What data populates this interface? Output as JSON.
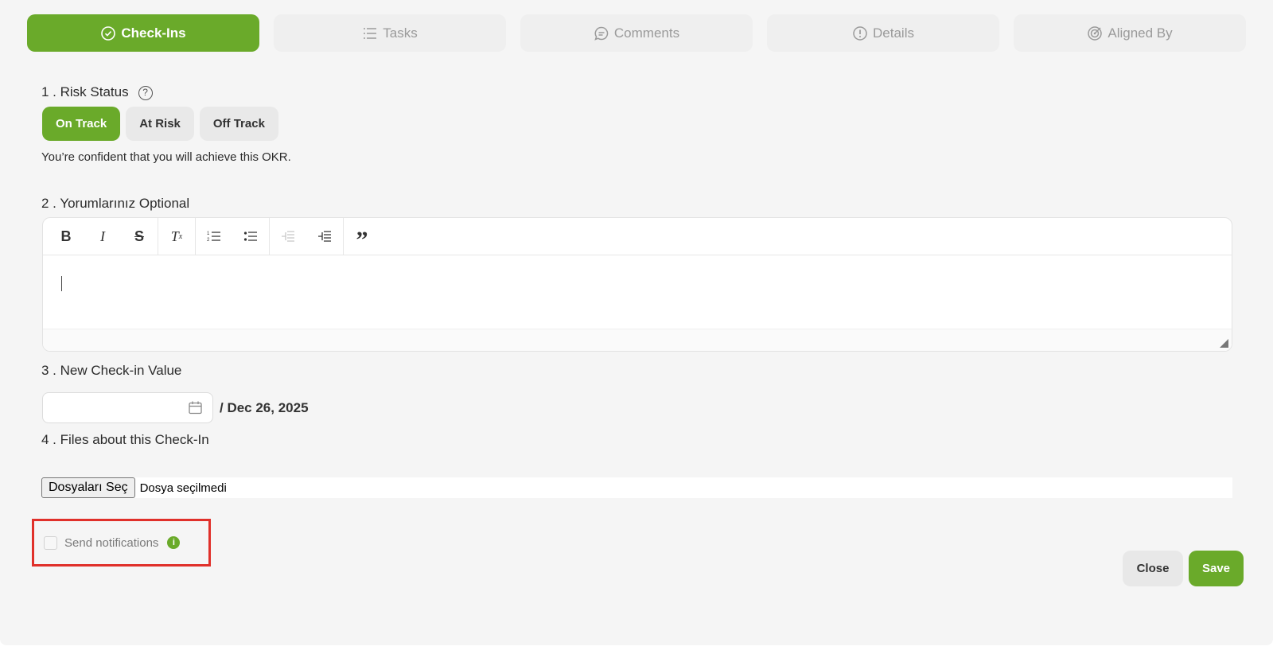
{
  "tabs": [
    {
      "label": "Check-Ins",
      "icon": "check-circle-icon",
      "active": true
    },
    {
      "label": "Tasks",
      "icon": "list-icon",
      "active": false
    },
    {
      "label": "Comments",
      "icon": "comment-icon",
      "active": false
    },
    {
      "label": "Details",
      "icon": "info-circle-icon",
      "active": false
    },
    {
      "label": "Aligned By",
      "icon": "target-icon",
      "active": false
    }
  ],
  "section1": {
    "title": "1 . Risk Status",
    "help": "?",
    "options": [
      "On Track",
      "At Risk",
      "Off Track"
    ],
    "selected": "On Track",
    "description": "You’re confident that you will achieve this OKR."
  },
  "section2": {
    "title": "2 . Yorumlarınız Optional",
    "toolbar": [
      "bold-icon",
      "italic-icon",
      "strikethrough-icon",
      "clear-format-icon",
      "ordered-list-icon",
      "bullet-list-icon",
      "outdent-icon",
      "indent-icon",
      "blockquote-icon"
    ]
  },
  "section3": {
    "title": "3 . New Check-in Value",
    "input_value": "",
    "suffix": "/ Dec 26, 2025"
  },
  "section4": {
    "title": "4 . Files about this Check-In",
    "choose_label": "Dosyaları Seç",
    "no_file_text": "Dosya seçilmedi"
  },
  "notifications": {
    "label": "Send notifications",
    "checked": false,
    "info": "i"
  },
  "actions": {
    "close": "Close",
    "save": "Save"
  },
  "colors": {
    "accent": "#6aaa2a",
    "highlight_border": "#e0302a"
  }
}
